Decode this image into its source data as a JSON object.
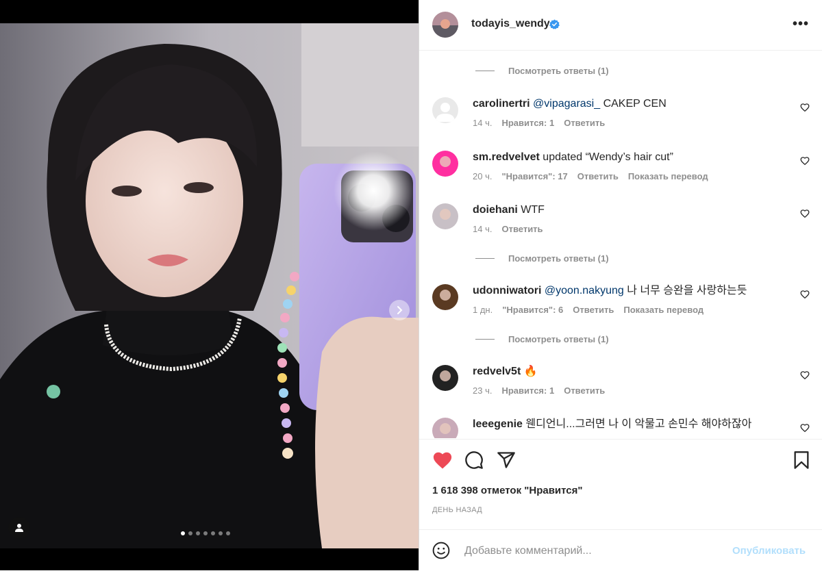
{
  "post": {
    "image_pager": {
      "total": 7,
      "current": 1
    }
  },
  "header": {
    "username": "todayis_wendy",
    "more_label": "•••"
  },
  "comments": [
    {
      "type": "replies",
      "label": "Посмотреть ответы (1)"
    },
    {
      "type": "comment",
      "user": "carolinertri",
      "mention": "@vipagarasi_",
      "text": " CAKEP CEN",
      "time": "14 ч.",
      "likes": "Нравится: 1",
      "reply": "Ответить",
      "translate": ""
    },
    {
      "type": "comment",
      "user": "sm.redvelvet",
      "mention": "",
      "text": " updated “Wendy’s hair cut”",
      "time": "20 ч.",
      "likes": "\"Нравится\": 17",
      "reply": "Ответить",
      "translate": "Показать перевод"
    },
    {
      "type": "comment",
      "user": "doiehani",
      "mention": "",
      "text": " WTF",
      "time": "14 ч.",
      "likes": "",
      "reply": "Ответить",
      "translate": ""
    },
    {
      "type": "replies",
      "label": "Посмотреть ответы (1)"
    },
    {
      "type": "comment",
      "user": "udonniwatori",
      "mention": "@yoon.nakyung",
      "text": " 나 너무 승완을 사랑하는듯",
      "time": "1 дн.",
      "likes": "\"Нравится\": 6",
      "reply": "Ответить",
      "translate": "Показать перевод"
    },
    {
      "type": "replies",
      "label": "Посмотреть ответы (1)"
    },
    {
      "type": "comment",
      "user": "redvelv5t",
      "mention": "",
      "text": " 🔥",
      "time": "23 ч.",
      "likes": "Нравится: 1",
      "reply": "Ответить",
      "translate": ""
    },
    {
      "type": "comment",
      "user": "leeegenie",
      "mention": "",
      "text": " 웬디언니...그러면 나 이 악물고 손민수 해야하잖아",
      "time": "",
      "likes": "",
      "reply": "",
      "translate": ""
    }
  ],
  "actions": {
    "likes_count": "1 618 398 отметок \"Нравится\"",
    "date": "ДЕНЬ НАЗАД"
  },
  "add_comment": {
    "placeholder": "Добавьте комментарий...",
    "post_label": "Опубликовать"
  },
  "colors": {
    "liked": "#ed4956",
    "link": "#00376b",
    "post_disabled": "#b2dffc",
    "verified": "#3897f0"
  }
}
